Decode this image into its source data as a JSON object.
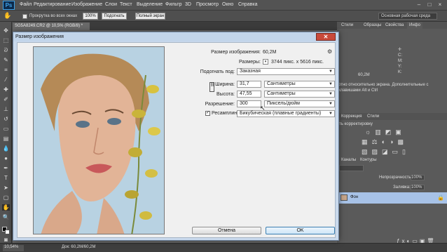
{
  "app": {
    "logo": "Ps"
  },
  "menubar": {
    "items": [
      "Файл",
      "Редактирование",
      "Изображение",
      "Слои",
      "Текст",
      "Выделение",
      "Фильтр",
      "3D",
      "Просмотр",
      "Окно",
      "Справка"
    ],
    "workspace": "Основная рабочая среда"
  },
  "optionsbar": {
    "scroll_all_label": "Прокрутка во всех окнах",
    "zoom_value": "100%",
    "fit_button": "Подогнать",
    "fullscreen_button": "Полный экран"
  },
  "document": {
    "tab_title": "SG5A8249.CR2 @ 10,5% (RGB/8) *",
    "zoom": "10,54%",
    "doc_info": "Док: 60,2M/60,2M"
  },
  "right_panels": {
    "tabs_top": [
      "Стили",
      "Образцы",
      "Свойства",
      "Инфо"
    ],
    "info_text_1": "60,2M",
    "info_text_2": "отно относительно экрана. Дополнительные с клавишами Alt и Ctrl",
    "tabs_mid": [
      "Коррекция",
      "Стили"
    ],
    "adjust_label": "ть корректировку",
    "tabs_layers": [
      "Каналы",
      "Контуры"
    ],
    "opacity_label": "Непрозрачность:",
    "opacity_value": "100%",
    "fill_label": "Заливка:",
    "fill_value": "100%",
    "layer_name": "Фон"
  },
  "dialog": {
    "title": "Размер изображения",
    "image_size_label": "Размер изображения:",
    "image_size_value": "60,2M",
    "dimensions_label": "Размеры:",
    "dimensions_value": "3744 пикс. x 5616 пикс.",
    "fit_to_label": "Подогнать под:",
    "fit_to_value": "Заказная",
    "width_label": "Ширина:",
    "width_value": "31,7",
    "width_unit": "Сантиметры",
    "height_label": "Высота:",
    "height_value": "47,55",
    "height_unit": "Сантиметры",
    "resolution_label": "Разрешение:",
    "resolution_value": "300",
    "resolution_unit": "Пиксель/дюйм",
    "resample_label": "Ресамплинг:",
    "resample_value": "Бикубическая (плавные градиенты)",
    "cancel_button": "Отмена",
    "ok_button": "OK"
  }
}
